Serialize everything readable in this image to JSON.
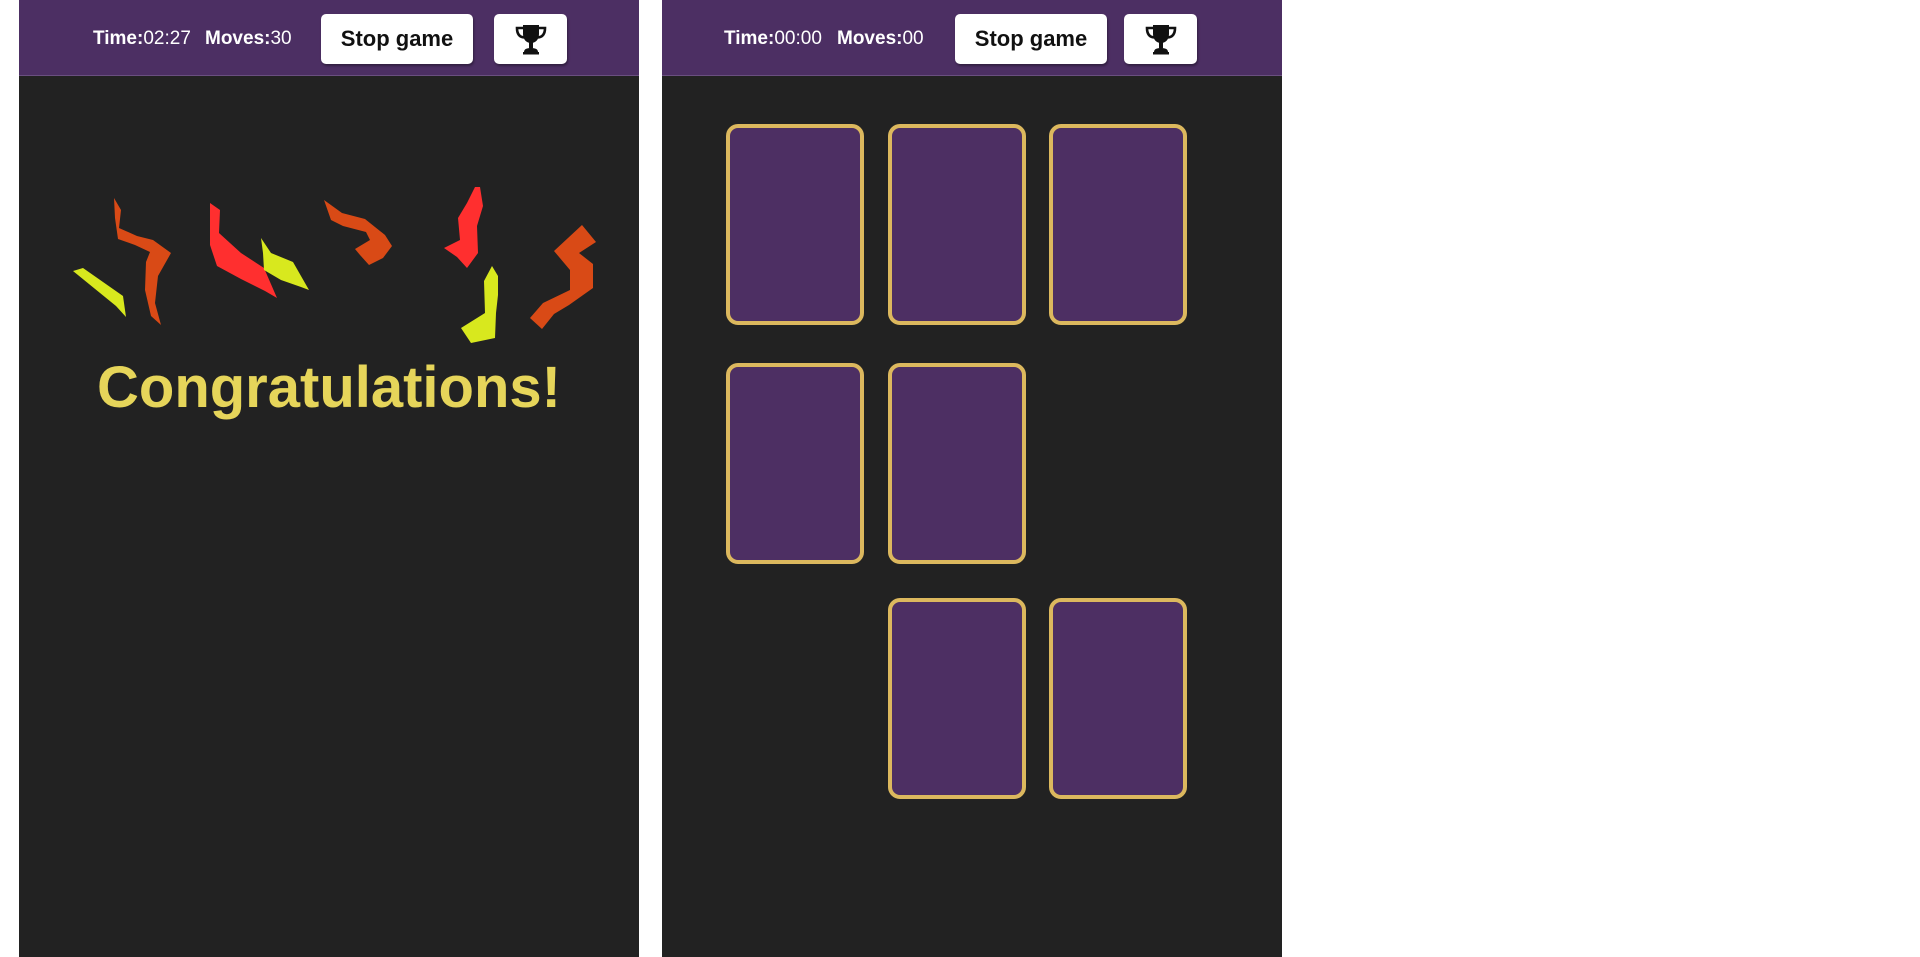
{
  "left_panel": {
    "time_label": "Time:",
    "time_value": "02:27",
    "moves_label": "Moves:",
    "moves_value": "30",
    "stop_button_label": "Stop game",
    "trophy_icon": "trophy-icon",
    "message": "Congratulations!"
  },
  "right_panel": {
    "time_label": "Time:",
    "time_value": "00:00",
    "moves_label": "Moves:",
    "moves_value": "00",
    "stop_button_label": "Stop game",
    "trophy_icon": "trophy-icon",
    "face_down_card_count": 7
  },
  "colors": {
    "header_bg": "#4c2f63",
    "board_bg": "#222222",
    "card_back": "#4d2f63",
    "card_border": "#dcb85e",
    "congrats_text": "#e6d55a",
    "confetti": [
      "#d94a16",
      "#ff2f2f",
      "#d8e81e",
      "#c84a16"
    ]
  }
}
